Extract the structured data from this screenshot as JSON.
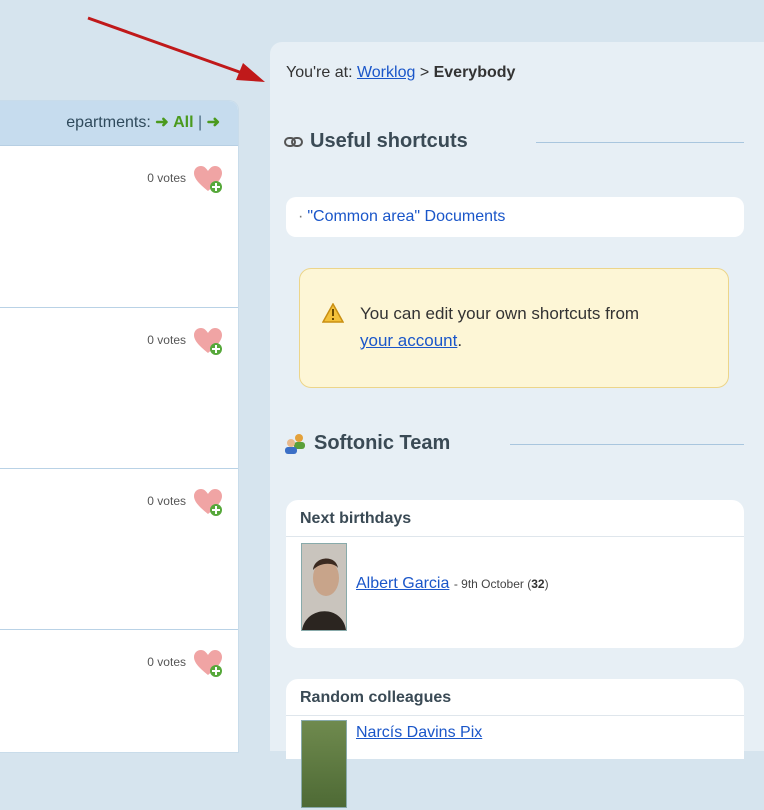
{
  "feed": {
    "header_prefix": "epartments:",
    "all_label": "All",
    "separator": "|",
    "entries": [
      {
        "votes": "0 votes"
      },
      {
        "votes": "0 votes"
      },
      {
        "votes": "0 votes"
      },
      {
        "votes": "0 votes"
      }
    ]
  },
  "breadcrumb": {
    "prefix": "You're at:",
    "link": "Worklog",
    "separator": ">",
    "current": "Everybody"
  },
  "shortcuts": {
    "title": "Useful shortcuts",
    "items": [
      {
        "label": "\"Common area\" Documents"
      }
    ],
    "notice_text": "You can edit your own shortcuts from",
    "notice_link": "your account",
    "notice_end": "."
  },
  "team": {
    "title": "Softonic Team",
    "birthdays": {
      "title": "Next birthdays",
      "people": [
        {
          "name": "Albert Garcia",
          "date": "- 9th October (",
          "age": "32",
          "close": ")"
        }
      ]
    },
    "random": {
      "title": "Random colleagues",
      "people": [
        {
          "name": "Narcís Davins Pix"
        }
      ]
    }
  },
  "colors": {
    "link": "#1a56c9",
    "green_accent": "#4a9a1d",
    "annotation_arrow": "#c0191a"
  },
  "icons": [
    "right-arrow-icon",
    "add-vote-heart-icon",
    "link-chain-icon",
    "warning-icon",
    "team-users-icon"
  ]
}
